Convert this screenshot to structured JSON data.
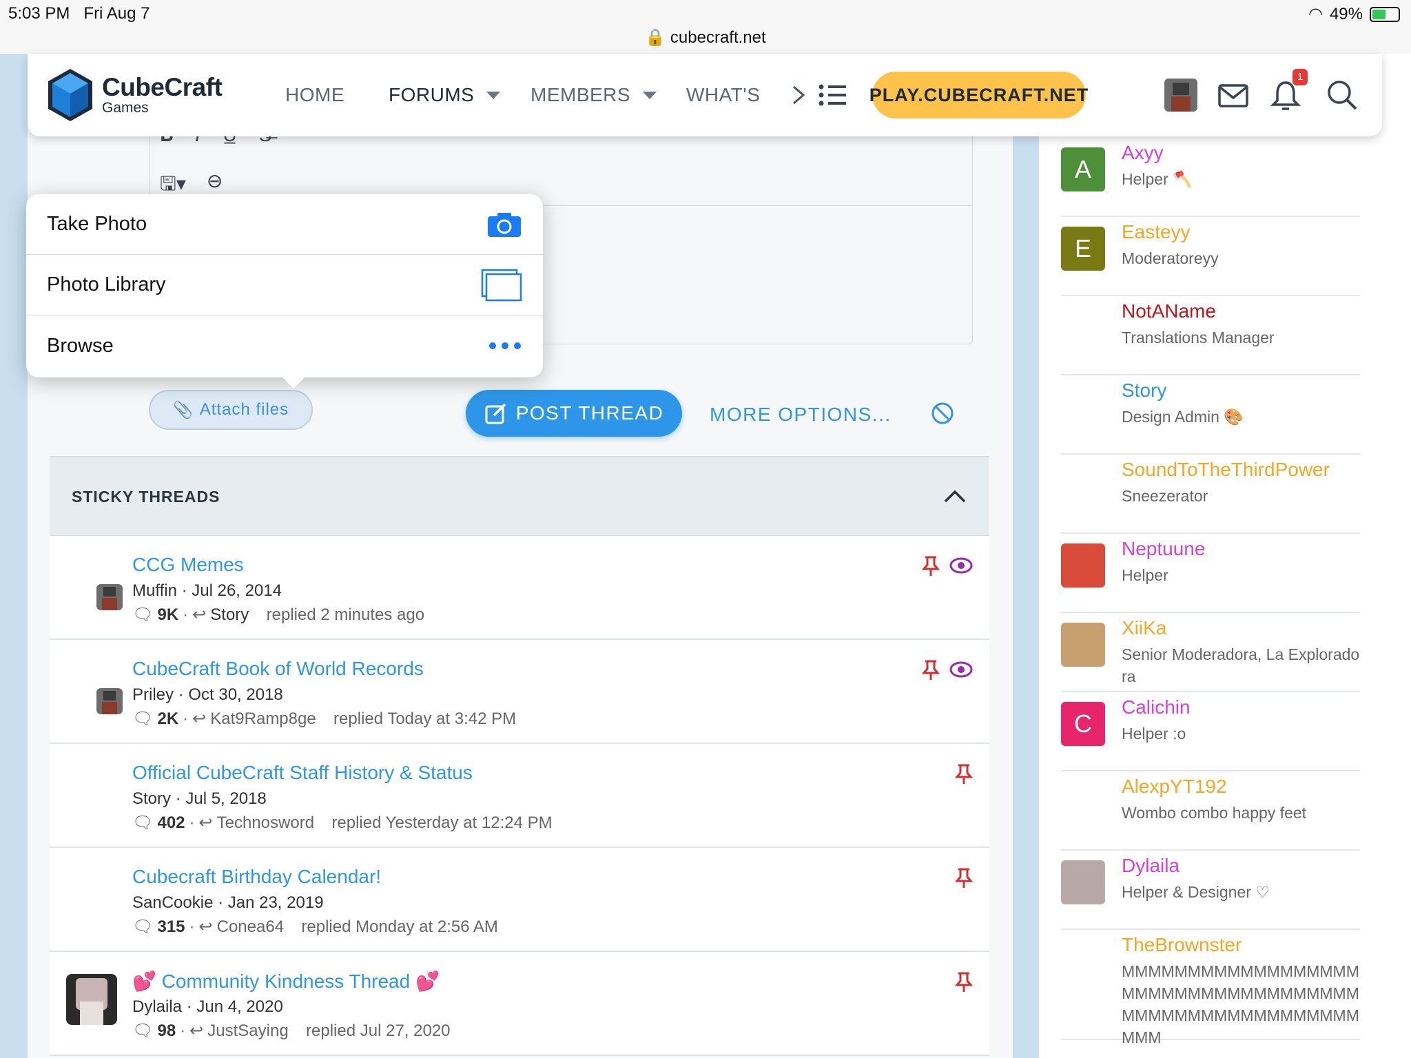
{
  "status_bar": {
    "time": "5:03 PM",
    "date": "Fri Aug 7",
    "url": "cubecraft.net",
    "battery": "49%"
  },
  "logo": {
    "name": "CubeCraft",
    "sub": "Games"
  },
  "nav": {
    "home": "HOME",
    "forums": "FORUMS",
    "members": "MEMBERS",
    "whats": "WHAT'S",
    "play": "PLAY.CUBECRAFT.NET",
    "notif_count": "1"
  },
  "popover": {
    "take_photo": "Take Photo",
    "photo_library": "Photo Library",
    "browse": "Browse"
  },
  "actions": {
    "attach": "Attach files",
    "post": "POST THREAD",
    "more": "MORE OPTIONS..."
  },
  "sticky": {
    "header": "STICKY THREADS",
    "threads": [
      {
        "title": "CCG Memes",
        "author": "Muffin",
        "date": "Jul 26, 2014",
        "replies": "9K",
        "last_user": "Story",
        "last_time": "replied 2 minutes ago"
      },
      {
        "title": "CubeCraft Book of World Records",
        "author": "Priley",
        "date": "Oct 30, 2018",
        "replies": "2K",
        "last_user": "Kat9Ramp8ge",
        "last_time": "replied Today at 3:42 PM"
      },
      {
        "title": "Official CubeCraft Staff History & Status",
        "author": "Story",
        "date": "Jul 5, 2018",
        "replies": "402",
        "last_user": "Technosword",
        "last_time": "replied Yesterday at 12:24 PM"
      },
      {
        "title": "Cubecraft Birthday Calendar!",
        "author": "SanCookie",
        "date": "Jan 23, 2019",
        "replies": "315",
        "last_user": "Conea64",
        "last_time": "replied Monday at 2:56 AM"
      },
      {
        "title": "💕 Community Kindness Thread 💕",
        "author": "Dylaila",
        "date": "Jun 4, 2020",
        "replies": "98",
        "last_user": "JustSaying",
        "last_time": "replied Jul 27, 2020"
      }
    ]
  },
  "members": [
    {
      "name": "Axyy",
      "role": "Helper 🪓",
      "initial": "A",
      "color": "#d63fd9",
      "av": "#4e8f3a"
    },
    {
      "name": "Easteyy",
      "role": "Moderatoreyy",
      "initial": "E",
      "color": "#f5a623",
      "av": "#7a7a14"
    },
    {
      "name": "NotAName",
      "role": "Translations Manager",
      "initial": "",
      "color": "#c0161b",
      "av": ""
    },
    {
      "name": "Story",
      "role": "Design Admin 🎨",
      "initial": "",
      "color": "#2e96e8",
      "av": ""
    },
    {
      "name": "SoundToTheThirdPower",
      "role": "Sneezerator",
      "initial": "",
      "color": "#f5a623",
      "av": ""
    },
    {
      "name": "Neptuune",
      "role": "Helper",
      "initial": "",
      "color": "#d63fd9",
      "av": "#d94c3a"
    },
    {
      "name": "XiiKa",
      "role": "Senior Moderadora, La Exploradora",
      "initial": "",
      "color": "#f5a623",
      "av": "#c8a070"
    },
    {
      "name": "Calichin",
      "role": "Helper :o",
      "initial": "C",
      "color": "#d63fd9",
      "av": "#e8246a"
    },
    {
      "name": "AlexpYT192",
      "role": "Wombo combo happy feet",
      "initial": "",
      "color": "#f5a623",
      "av": ""
    },
    {
      "name": "Dylaila",
      "role": "Helper & Designer ♡",
      "initial": "",
      "color": "#d63fd9",
      "av": "#b9a8a8"
    },
    {
      "name": "TheBrownster",
      "role": "MMMMMMMMMMMMMMMMMMMMMMMMMMMMMMMMMMMMMMMMMMMMMMMMMMMMMMMMM",
      "initial": "",
      "color": "#f5a623",
      "av": ""
    }
  ]
}
